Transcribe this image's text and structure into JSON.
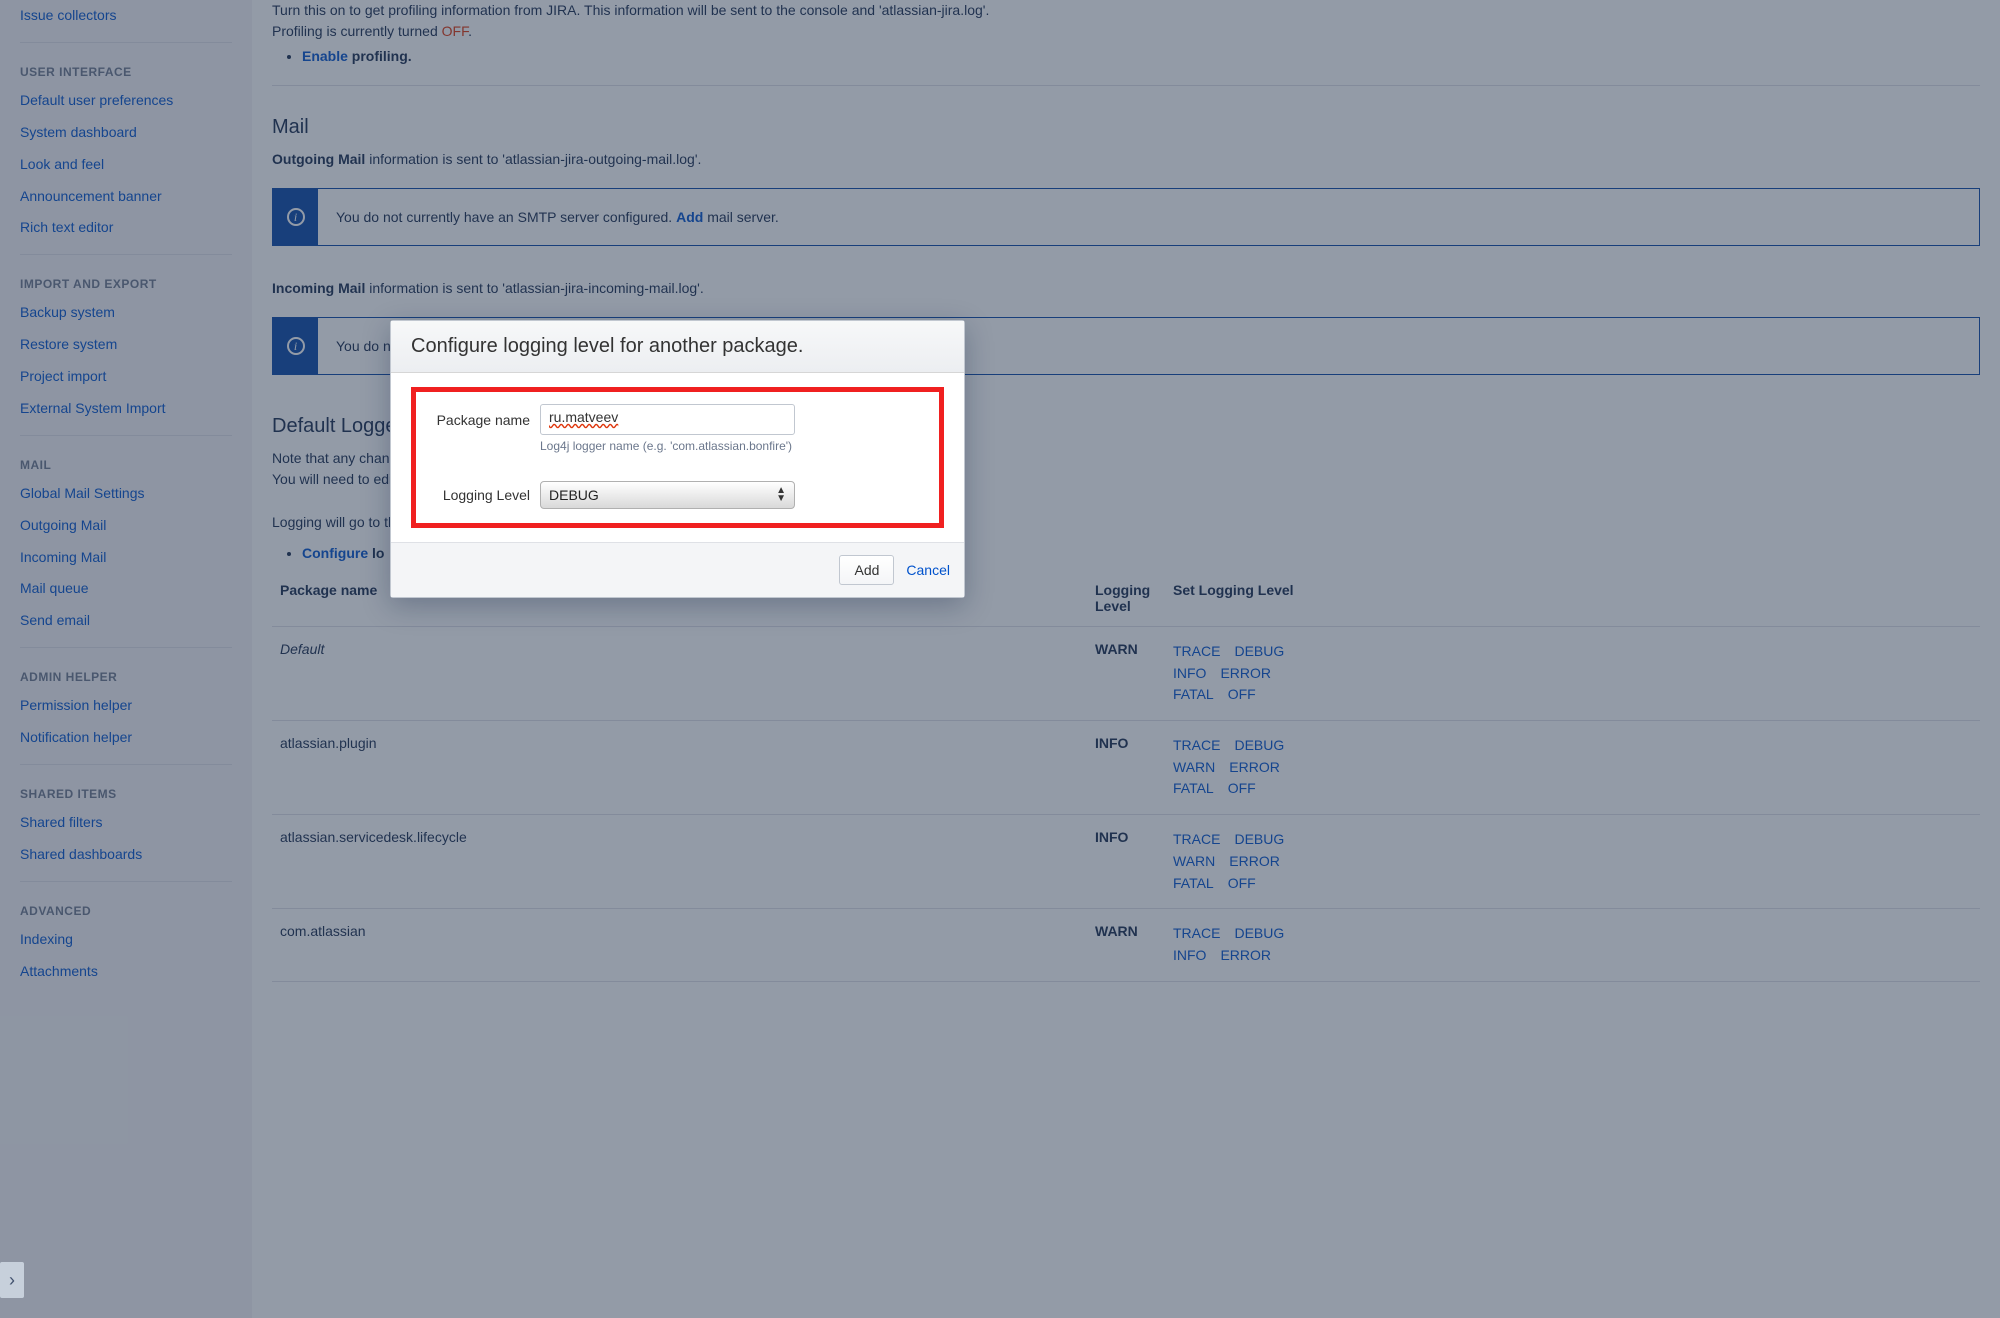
{
  "sidebar": {
    "items_top": [
      "Issue collectors"
    ],
    "sections": [
      {
        "title": "USER INTERFACE",
        "items": [
          "Default user preferences",
          "System dashboard",
          "Look and feel",
          "Announcement banner",
          "Rich text editor"
        ]
      },
      {
        "title": "IMPORT AND EXPORT",
        "items": [
          "Backup system",
          "Restore system",
          "Project import",
          "External System Import"
        ]
      },
      {
        "title": "MAIL",
        "items": [
          "Global Mail Settings",
          "Outgoing Mail",
          "Incoming Mail",
          "Mail queue",
          "Send email"
        ]
      },
      {
        "title": "ADMIN HELPER",
        "items": [
          "Permission helper",
          "Notification helper"
        ]
      },
      {
        "title": "SHARED ITEMS",
        "items": [
          "Shared filters",
          "Shared dashboards"
        ]
      },
      {
        "title": "ADVANCED",
        "items": [
          "Indexing",
          "Attachments"
        ]
      }
    ]
  },
  "profiling": {
    "text_pre": "Turn this on to get profiling information from JIRA. This information will be sent to the console and 'atlassian-jira.log'.",
    "text_line2_pre": "Profiling is currently turned ",
    "off": "OFF",
    "dot": ".",
    "enable_link": "Enable",
    "enable_suffix": " profiling."
  },
  "mail": {
    "heading": "Mail",
    "outgoing_bold": "Outgoing Mail",
    "outgoing_rest": " information is sent to 'atlassian-jira-outgoing-mail.log'.",
    "smtp_pre": "You do not currently have an SMTP server configured. ",
    "smtp_link": "Add",
    "smtp_post": " mail server.",
    "incoming_bold": "Incoming Mail",
    "incoming_rest": " information is sent to 'atlassian-jira-incoming-mail.log'.",
    "pop_pre": "You do no"
  },
  "loggers": {
    "heading": "Default Loggers",
    "note1": "Note that any chang",
    "note2": "You will need to edi",
    "logging_will": "Logging will go to th",
    "configure_link": "Configure",
    "configure_suffix": " lo",
    "col_package": "Package name",
    "col_level": "Logging Level",
    "col_set": "Set Logging Level",
    "rows": [
      {
        "pkg": "Default",
        "italic": true,
        "level": "WARN",
        "levels": [
          "TRACE",
          "DEBUG",
          "INFO",
          "ERROR",
          "FATAL",
          "OFF"
        ]
      },
      {
        "pkg": "atlassian.plugin",
        "italic": false,
        "level": "INFO",
        "levels": [
          "TRACE",
          "DEBUG",
          "WARN",
          "ERROR",
          "FATAL",
          "OFF"
        ]
      },
      {
        "pkg": "atlassian.servicedesk.lifecycle",
        "italic": false,
        "level": "INFO",
        "levels": [
          "TRACE",
          "DEBUG",
          "WARN",
          "ERROR",
          "FATAL",
          "OFF"
        ]
      },
      {
        "pkg": "com.atlassian",
        "italic": false,
        "level": "WARN",
        "levels": [
          "TRACE",
          "DEBUG",
          "INFO",
          "ERROR"
        ]
      }
    ]
  },
  "dialog": {
    "title": "Configure logging level for another package.",
    "label_package": "Package name",
    "value_package": "ru.matveev",
    "hint": "Log4j logger name (e.g. 'com.atlassian.bonfire')",
    "label_level": "Logging Level",
    "value_level": "DEBUG",
    "btn_add": "Add",
    "btn_cancel": "Cancel"
  }
}
